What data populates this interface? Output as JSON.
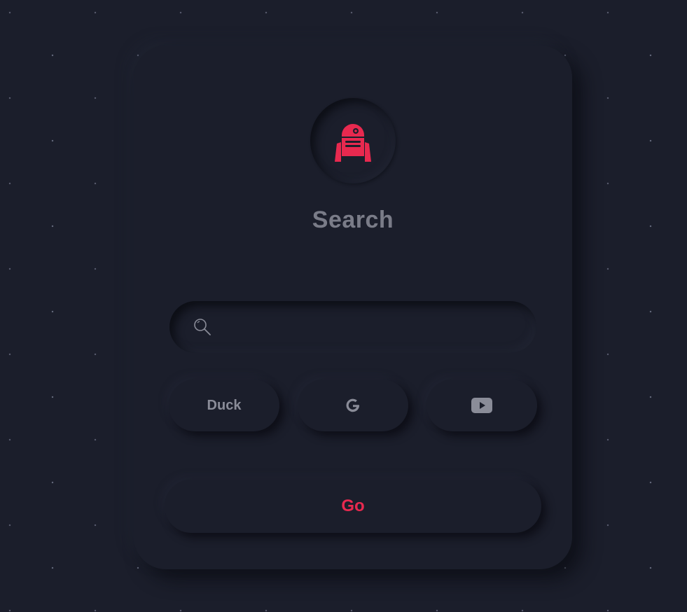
{
  "page": {
    "title": "Search"
  },
  "avatar": {
    "icon": "robot-icon",
    "color": "#e8294f"
  },
  "search": {
    "value": "",
    "placeholder": "",
    "icon": "search-icon"
  },
  "engines": [
    {
      "label": "Duck",
      "icon": ""
    },
    {
      "label": "",
      "icon": "google-icon"
    },
    {
      "label": "",
      "icon": "youtube-icon"
    }
  ],
  "actions": {
    "go_label": "Go"
  },
  "colors": {
    "background": "#1b1e2b",
    "accent": "#e8294f",
    "muted_text": "#7a7c88"
  }
}
